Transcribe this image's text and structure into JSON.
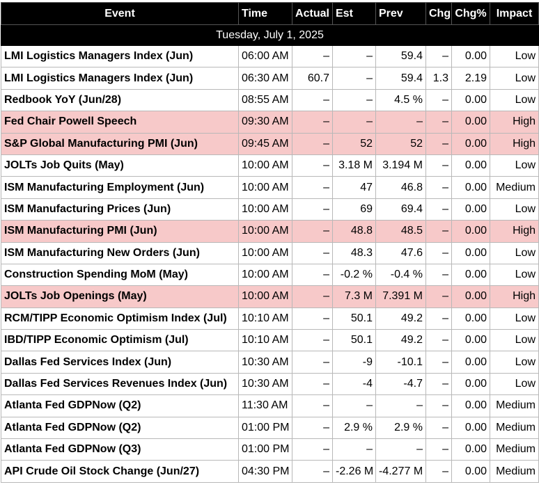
{
  "headers": {
    "event": "Event",
    "time": "Time",
    "actual": "Actual",
    "est": "Est",
    "prev": "Prev",
    "chg": "Chg",
    "chg_pct": "Chg%",
    "impact": "Impact"
  },
  "date_label": "Tuesday, July 1, 2025",
  "rows": [
    {
      "event": "LMI Logistics Managers Index (Jun)",
      "time": "06:00 AM",
      "actual": "–",
      "est": "–",
      "prev": "59.4",
      "chg": "–",
      "chg_pct": "0.00",
      "impact": "Low"
    },
    {
      "event": "LMI Logistics Managers Index (Jun)",
      "time": "06:30 AM",
      "actual": "60.7",
      "est": "–",
      "prev": "59.4",
      "chg": "1.3",
      "chg_pct": "2.19",
      "impact": "Low"
    },
    {
      "event": "Redbook YoY (Jun/28)",
      "time": "08:55 AM",
      "actual": "–",
      "est": "–",
      "prev": "4.5 %",
      "chg": "–",
      "chg_pct": "0.00",
      "impact": "Low"
    },
    {
      "event": "Fed Chair Powell Speech",
      "time": "09:30 AM",
      "actual": "–",
      "est": "–",
      "prev": "–",
      "chg": "–",
      "chg_pct": "0.00",
      "impact": "High"
    },
    {
      "event": "S&P Global Manufacturing PMI (Jun)",
      "time": "09:45 AM",
      "actual": "–",
      "est": "52",
      "prev": "52",
      "chg": "–",
      "chg_pct": "0.00",
      "impact": "High"
    },
    {
      "event": "JOLTs Job Quits (May)",
      "time": "10:00 AM",
      "actual": "–",
      "est": "3.18 M",
      "prev": "3.194 M",
      "chg": "–",
      "chg_pct": "0.00",
      "impact": "Low"
    },
    {
      "event": "ISM Manufacturing Employment (Jun)",
      "time": "10:00 AM",
      "actual": "–",
      "est": "47",
      "prev": "46.8",
      "chg": "–",
      "chg_pct": "0.00",
      "impact": "Medium"
    },
    {
      "event": "ISM Manufacturing Prices (Jun)",
      "time": "10:00 AM",
      "actual": "–",
      "est": "69",
      "prev": "69.4",
      "chg": "–",
      "chg_pct": "0.00",
      "impact": "Low"
    },
    {
      "event": "ISM Manufacturing PMI (Jun)",
      "time": "10:00 AM",
      "actual": "–",
      "est": "48.8",
      "prev": "48.5",
      "chg": "–",
      "chg_pct": "0.00",
      "impact": "High"
    },
    {
      "event": "ISM Manufacturing New Orders (Jun)",
      "time": "10:00 AM",
      "actual": "–",
      "est": "48.3",
      "prev": "47.6",
      "chg": "–",
      "chg_pct": "0.00",
      "impact": "Low"
    },
    {
      "event": "Construction Spending MoM (May)",
      "time": "10:00 AM",
      "actual": "–",
      "est": "-0.2 %",
      "prev": "-0.4 %",
      "chg": "–",
      "chg_pct": "0.00",
      "impact": "Low"
    },
    {
      "event": "JOLTs Job Openings (May)",
      "time": "10:00 AM",
      "actual": "–",
      "est": "7.3 M",
      "prev": "7.391 M",
      "chg": "–",
      "chg_pct": "0.00",
      "impact": "High"
    },
    {
      "event": "RCM/TIPP Economic Optimism Index (Jul)",
      "time": "10:10 AM",
      "actual": "–",
      "est": "50.1",
      "prev": "49.2",
      "chg": "–",
      "chg_pct": "0.00",
      "impact": "Low"
    },
    {
      "event": "IBD/TIPP Economic Optimism (Jul)",
      "time": "10:10 AM",
      "actual": "–",
      "est": "50.1",
      "prev": "49.2",
      "chg": "–",
      "chg_pct": "0.00",
      "impact": "Low"
    },
    {
      "event": "Dallas Fed Services Index (Jun)",
      "time": "10:30 AM",
      "actual": "–",
      "est": "-9",
      "prev": "-10.1",
      "chg": "–",
      "chg_pct": "0.00",
      "impact": "Low"
    },
    {
      "event": "Dallas Fed Services Revenues Index (Jun)",
      "time": "10:30 AM",
      "actual": "–",
      "est": "-4",
      "prev": "-4.7",
      "chg": "–",
      "chg_pct": "0.00",
      "impact": "Low"
    },
    {
      "event": "Atlanta Fed GDPNow (Q2)",
      "time": "11:30 AM",
      "actual": "–",
      "est": "–",
      "prev": "–",
      "chg": "–",
      "chg_pct": "0.00",
      "impact": "Medium"
    },
    {
      "event": "Atlanta Fed GDPNow (Q2)",
      "time": "01:00 PM",
      "actual": "–",
      "est": "2.9 %",
      "prev": "2.9 %",
      "chg": "–",
      "chg_pct": "0.00",
      "impact": "Medium"
    },
    {
      "event": "Atlanta Fed GDPNow (Q3)",
      "time": "01:00 PM",
      "actual": "–",
      "est": "–",
      "prev": "–",
      "chg": "–",
      "chg_pct": "0.00",
      "impact": "Medium"
    },
    {
      "event": "API Crude Oil Stock Change (Jun/27)",
      "time": "04:30 PM",
      "actual": "–",
      "est": "-2.26 M",
      "prev": "-4.277 M",
      "chg": "–",
      "chg_pct": "0.00",
      "impact": "Medium"
    }
  ],
  "colors": {
    "header_bg": "#000000",
    "header_text": "#ffffff",
    "high_impact_row_bg": "#f7c9c9",
    "grid_line": "#b8b8b8"
  }
}
